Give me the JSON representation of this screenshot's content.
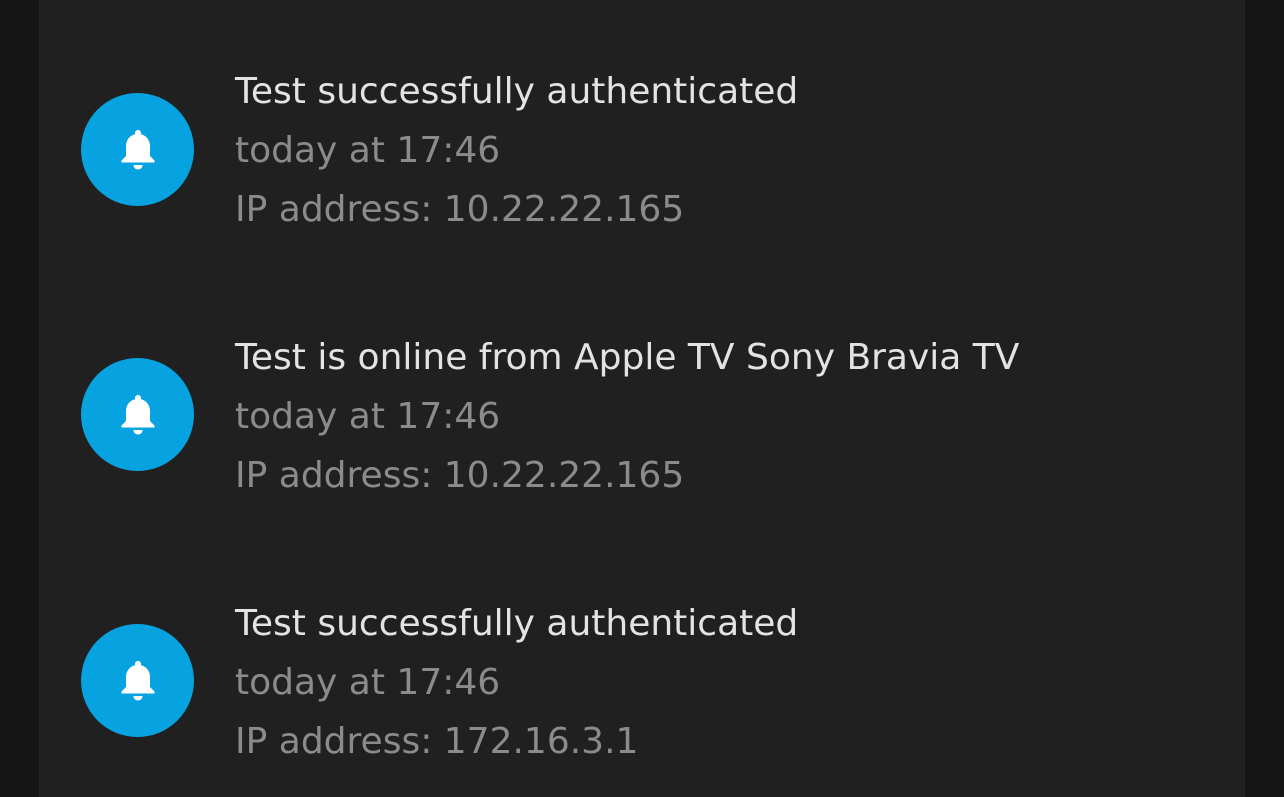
{
  "notifications": [
    {
      "title": "Test successfully authenticated",
      "time": "today at 17:46",
      "ip": "IP address: 10.22.22.165",
      "icon": "bell-icon"
    },
    {
      "title": "Test is online from Apple TV Sony Bravia TV",
      "time": "today at 17:46",
      "ip": "IP address: 10.22.22.165",
      "icon": "bell-icon"
    },
    {
      "title": "Test successfully authenticated",
      "time": "today at 17:46",
      "ip": "IP address: 172.16.3.1",
      "icon": "bell-icon"
    }
  ],
  "colors": {
    "background": "#151515",
    "panel": "#202020",
    "accent": "#07a3e0",
    "title_text": "#e3e3e3",
    "secondary_text": "#8b8b8b"
  }
}
